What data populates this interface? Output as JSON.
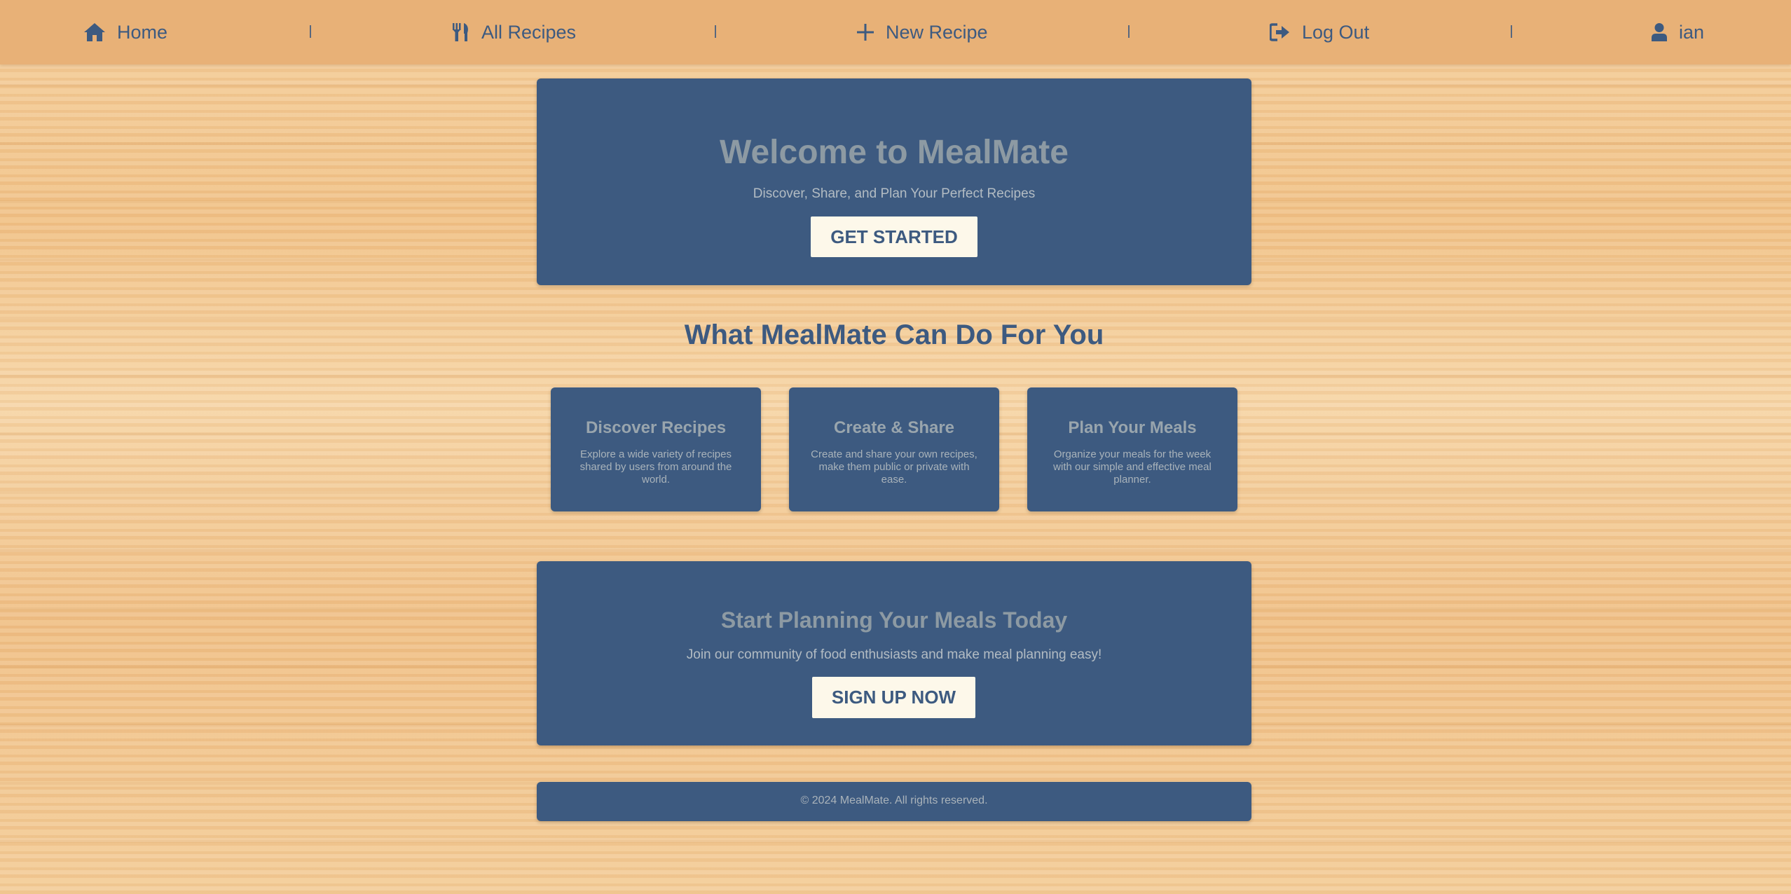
{
  "nav": {
    "home": {
      "label": "Home",
      "icon": "home-icon"
    },
    "all_recipes": {
      "label": "All Recipes",
      "icon": "utensils-icon"
    },
    "new_recipe": {
      "label": "New Recipe",
      "icon": "plus-icon"
    },
    "log_out": {
      "label": "Log Out",
      "icon": "sign-out-icon"
    },
    "user": {
      "label": "ian",
      "icon": "user-icon"
    }
  },
  "hero": {
    "title": "Welcome to MealMate",
    "subtitle": "Discover, Share, and Plan Your Perfect Recipes",
    "button_label": "GET STARTED"
  },
  "features": {
    "heading": "What MealMate Can Do For You",
    "cards": [
      {
        "title": "Discover Recipes",
        "text": "Explore a wide variety of recipes shared by users from around the world."
      },
      {
        "title": "Create & Share",
        "text": "Create and share your own recipes, make them public or private with ease."
      },
      {
        "title": "Plan Your Meals",
        "text": "Organize your meals for the week with our simple and effective meal planner."
      }
    ]
  },
  "cta": {
    "title": "Start Planning Your Meals Today",
    "subtitle": "Join our community of food enthusiasts and make meal planning easy!",
    "button_label": "SIGN UP NOW"
  },
  "footer": {
    "text": "© 2024 MealMate. All rights reserved."
  },
  "colors": {
    "navbar": "#e8b177",
    "panel": "#3d5a80",
    "button": "#fdf8ea",
    "heading": "#3d5a80"
  }
}
